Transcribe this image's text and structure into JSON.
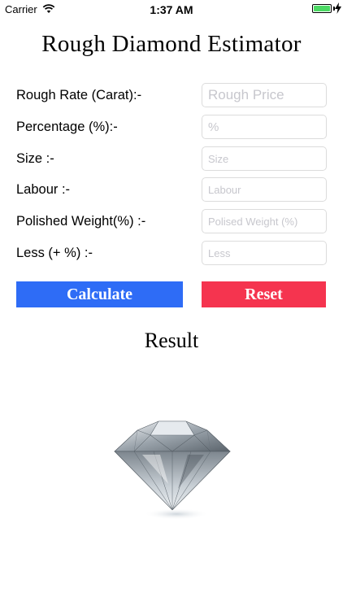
{
  "status_bar": {
    "carrier": "Carrier",
    "time": "1:37 AM"
  },
  "app": {
    "title": "Rough Diamond Estimator"
  },
  "form": {
    "fields": [
      {
        "label": "Rough Rate (Carat):-",
        "placeholder": "Rough Price",
        "value": ""
      },
      {
        "label": "Percentage (%):-",
        "placeholder": "%",
        "value": ""
      },
      {
        "label": "Size :-",
        "placeholder": "Size",
        "value": ""
      },
      {
        "label": "Labour :-",
        "placeholder": "Labour",
        "value": ""
      },
      {
        "label": "Polished Weight(%) :-",
        "placeholder": "Polised Weight (%)",
        "value": ""
      },
      {
        "label": "Less (+ %) :-",
        "placeholder": "Less",
        "value": ""
      }
    ]
  },
  "buttons": {
    "calculate": "Calculate",
    "reset": "Reset"
  },
  "result": {
    "title": "Result"
  },
  "colors": {
    "calculate": "#2e6cf6",
    "reset": "#f5344f",
    "battery": "#4cd964"
  },
  "icons": {
    "wifi": "wifi-icon",
    "battery": "battery-icon",
    "charging": "charging-icon",
    "diamond": "diamond-image"
  }
}
